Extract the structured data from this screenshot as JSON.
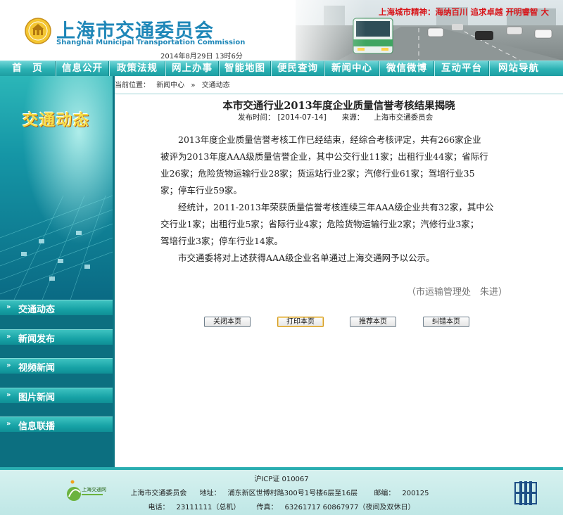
{
  "header": {
    "site_name": "上海市交通委员会",
    "site_name_en": "Shanghai Municipal Transportation Commission",
    "date": "2014年8月29日  13时6分",
    "slogan": "上海城市精神：海纳百川 追求卓越 开明睿智 大"
  },
  "nav": {
    "items": [
      {
        "label": "首　页"
      },
      {
        "label": "信息公开"
      },
      {
        "label": "政策法规"
      },
      {
        "label": "网上办事"
      },
      {
        "label": "智能地图"
      },
      {
        "label": "便民查询"
      },
      {
        "label": "新闻中心"
      },
      {
        "label": "微信微博"
      },
      {
        "label": "互动平台"
      },
      {
        "label": "网站导航"
      }
    ]
  },
  "sidebar": {
    "banner_title": "交通动态",
    "items": [
      {
        "label": "交通动态"
      },
      {
        "label": "新闻发布"
      },
      {
        "label": "视频新闻"
      },
      {
        "label": "图片新闻"
      },
      {
        "label": "信息联播"
      }
    ]
  },
  "breadcrumb": {
    "prefix": "当前位置：",
    "items": [
      "新闻中心",
      "»",
      "交通动态"
    ]
  },
  "article": {
    "title": "本市交通行业2013年度企业质量信誉考核结果揭晓",
    "publish_label": "发布时间：",
    "publish_date": "[2014-07-14]",
    "source_label": "来源：",
    "source": "上海市交通委员会",
    "paragraphs": [
      [
        "　　2013年度企业质量信誉考核工作已经结束，经综合考核评定，共有266家企业",
        "被评为2013年度AAA级质量信誉企业，其中公交行业11家；出租行业44家；省际行",
        "业26家；危险货物运输行业28家；货运站行业2家；汽修行业61家；驾培行业35",
        "家；停车行业59家。"
      ],
      [
        "　　经统计，2011-2013年荣获质量信誉考核连续三年AAA级企业共有32家，其中公",
        "交行业1家；出租行业5家；省际行业4家；危险货物运输行业2家；汽修行业3家；",
        "驾培行业3家；停车行业14家。"
      ],
      [
        "　　市交通委将对上述获得AAA级企业名单通过上海交通网予以公示。"
      ]
    ],
    "signature": "（市运输管理处　朱进）"
  },
  "buttons": {
    "close": "关闭本页",
    "print": "打印本页",
    "recommend": "推荐本页",
    "correct": "纠错本页"
  },
  "footer": {
    "icp": "沪ICP证 010067",
    "org": "上海市交通委员会",
    "address_label": "地址：",
    "address": "浦东新区世博村路300号1号楼6层至16层",
    "postcode_label": "邮编：",
    "postcode": "200125",
    "phone_label": "电话：",
    "phone": "23111111（总机）",
    "fax_label": "传真：",
    "fax": "63261717  60867977（夜间及双休日）",
    "left_logo_text": "上海交通网"
  },
  "colors": {
    "brand_blue": "#1f87b8",
    "nav_teal": "#2ab1b3",
    "sidebar_dark": "#0c6f80",
    "slogan_red": "#d8161a",
    "banner_yellow": "#f7e04a"
  }
}
